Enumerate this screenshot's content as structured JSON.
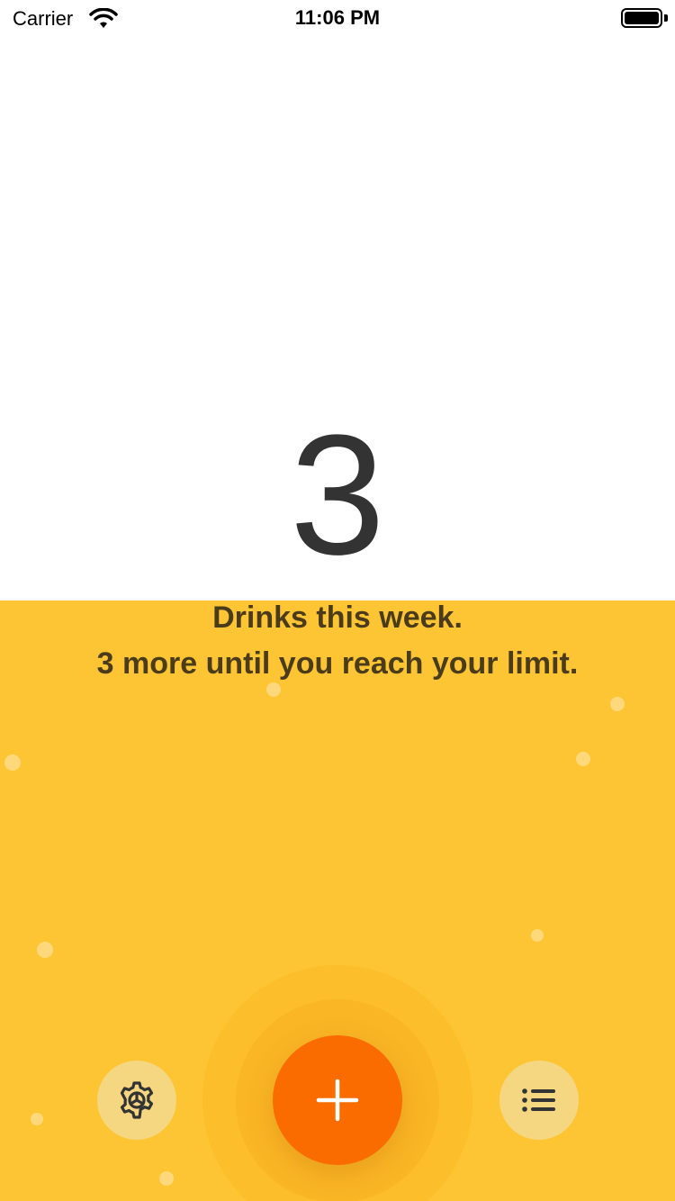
{
  "status_bar": {
    "carrier": "Carrier",
    "time": "11:06 PM"
  },
  "counter": {
    "value": "3"
  },
  "caption": {
    "line1": "Drinks this week.",
    "line2": "3 more until you reach your limit."
  },
  "buttons": {
    "settings_icon": "gear-icon",
    "add_icon": "plus-icon",
    "list_icon": "list-icon"
  },
  "colors": {
    "accent_yellow": "#fdc433",
    "add_orange": "#fb6c00",
    "text_dark": "#333333"
  }
}
